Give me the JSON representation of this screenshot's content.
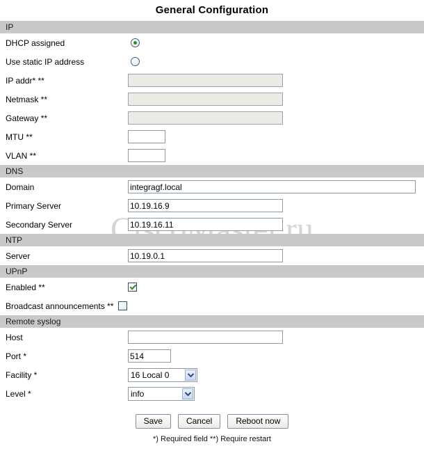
{
  "page": {
    "title": "General Configuration",
    "watermark": "CiscoMaster.ru",
    "footnote": "*) Required field **) Require restart"
  },
  "sections": {
    "ip": {
      "header": "IP",
      "dhcp_label": "DHCP assigned",
      "static_label": "Use static IP address",
      "ipaddr_label": "IP addr* **",
      "ipaddr_value": "",
      "netmask_label": "Netmask **",
      "netmask_value": "",
      "gateway_label": "Gateway **",
      "gateway_value": "",
      "mtu_label": "MTU **",
      "mtu_value": "",
      "vlan_label": "VLAN **",
      "vlan_value": ""
    },
    "dns": {
      "header": "DNS",
      "domain_label": "Domain",
      "domain_value": "integragf.local",
      "primary_label": "Primary Server",
      "primary_value": "10.19.16.9",
      "secondary_label": "Secondary Server",
      "secondary_value": "10.19.16.11"
    },
    "ntp": {
      "header": "NTP",
      "server_label": "Server",
      "server_value": "10.19.0.1"
    },
    "upnp": {
      "header": "UPnP",
      "enabled_label": "Enabled **",
      "broadcast_label": "Broadcast announcements **"
    },
    "syslog": {
      "header": "Remote syslog",
      "host_label": "Host",
      "host_value": "",
      "port_label": "Port *",
      "port_value": "514",
      "facility_label": "Facility *",
      "facility_value": "16 Local 0",
      "level_label": "Level *",
      "level_value": "info"
    }
  },
  "buttons": {
    "save": "Save",
    "cancel": "Cancel",
    "reboot": "Reboot now"
  },
  "colors": {
    "section_bar": "#c9c9c9",
    "field_border": "#8a9aa7",
    "disabled_field": "#eceae4",
    "check_green": "#2e8b33",
    "watermark": "#d8d5d0"
  }
}
